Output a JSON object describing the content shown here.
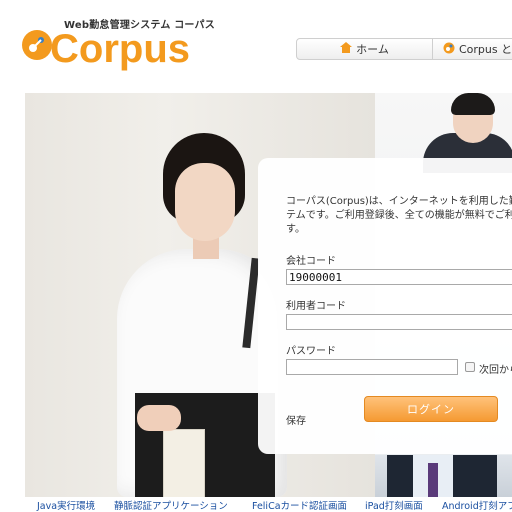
{
  "logo": {
    "tagline": "Web勤怠管理システム コーパス",
    "name": "Corpus"
  },
  "nav": {
    "items": [
      {
        "label": "ホーム",
        "icon": "home-icon"
      },
      {
        "label": "Corpus と",
        "icon": "corpus-logo-icon"
      }
    ]
  },
  "login": {
    "description": "コーパス(Corpus)は、インターネットを利用した勤\nテムです。ご利用登録後、全ての機能が無料でご利\nす。",
    "company_code_label": "会社コード",
    "company_code_value": "19000001",
    "user_code_label": "利用者コード",
    "user_code_value": "",
    "password_label": "パスワード",
    "password_value": "",
    "remember_label": "次回から",
    "save_label": "保存",
    "login_button": "ログイン"
  },
  "footer_links": [
    "Java実行環境",
    "静脈認証アプリケーション",
    "FeliCaカード認証画面",
    "iPad打刻画面",
    "Android打刻アプ"
  ],
  "colors": {
    "brand": "#f39a1e",
    "link": "#1a4fa0",
    "button": "#f59a32"
  }
}
